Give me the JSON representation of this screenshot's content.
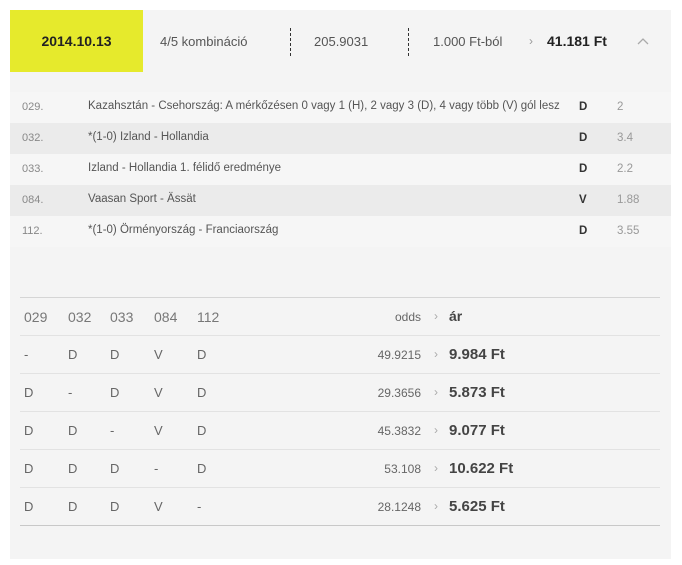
{
  "header": {
    "date": "2014.10.13",
    "combination": "4/5 kombináció",
    "total_odds": "205.9031",
    "stake": "1.000 Ft-ból",
    "arrow": "›",
    "win": "41.181 Ft",
    "collapse_icon": "chevron-up-icon",
    "accent_color": "#e6ea2c"
  },
  "bets": [
    {
      "num": "029.",
      "name": "Kazahsztán - Csehország: A mérkőzésen 0 vagy 1 (H), 2 vagy 3 (D), 4 vagy több (V) gól lesz",
      "pick": "D",
      "odds": "2"
    },
    {
      "num": "032.",
      "name": "*(1-0) Izland - Hollandia",
      "pick": "D",
      "odds": "3.4"
    },
    {
      "num": "033.",
      "name": "Izland - Hollandia 1. félidő eredménye",
      "pick": "D",
      "odds": "2.2"
    },
    {
      "num": "084.",
      "name": "Vaasan Sport - Ässät",
      "pick": "V",
      "odds": "1.88"
    },
    {
      "num": "112.",
      "name": "*(1-0) Örményország - Franciaország",
      "pick": "D",
      "odds": "3.55"
    }
  ],
  "combos": {
    "columns": [
      "029",
      "032",
      "033",
      "084",
      "112"
    ],
    "odds_label": "odds",
    "price_label": "ár",
    "arrow": "›",
    "rows": [
      {
        "cells": [
          "-",
          "D",
          "D",
          "V",
          "D"
        ],
        "odds": "49.9215",
        "price": "9.984 Ft"
      },
      {
        "cells": [
          "D",
          "-",
          "D",
          "V",
          "D"
        ],
        "odds": "29.3656",
        "price": "5.873 Ft"
      },
      {
        "cells": [
          "D",
          "D",
          "-",
          "V",
          "D"
        ],
        "odds": "45.3832",
        "price": "9.077 Ft"
      },
      {
        "cells": [
          "D",
          "D",
          "D",
          "-",
          "D"
        ],
        "odds": "53.108",
        "price": "10.622 Ft"
      },
      {
        "cells": [
          "D",
          "D",
          "D",
          "V",
          "-"
        ],
        "odds": "28.1248",
        "price": "5.625 Ft"
      }
    ]
  }
}
